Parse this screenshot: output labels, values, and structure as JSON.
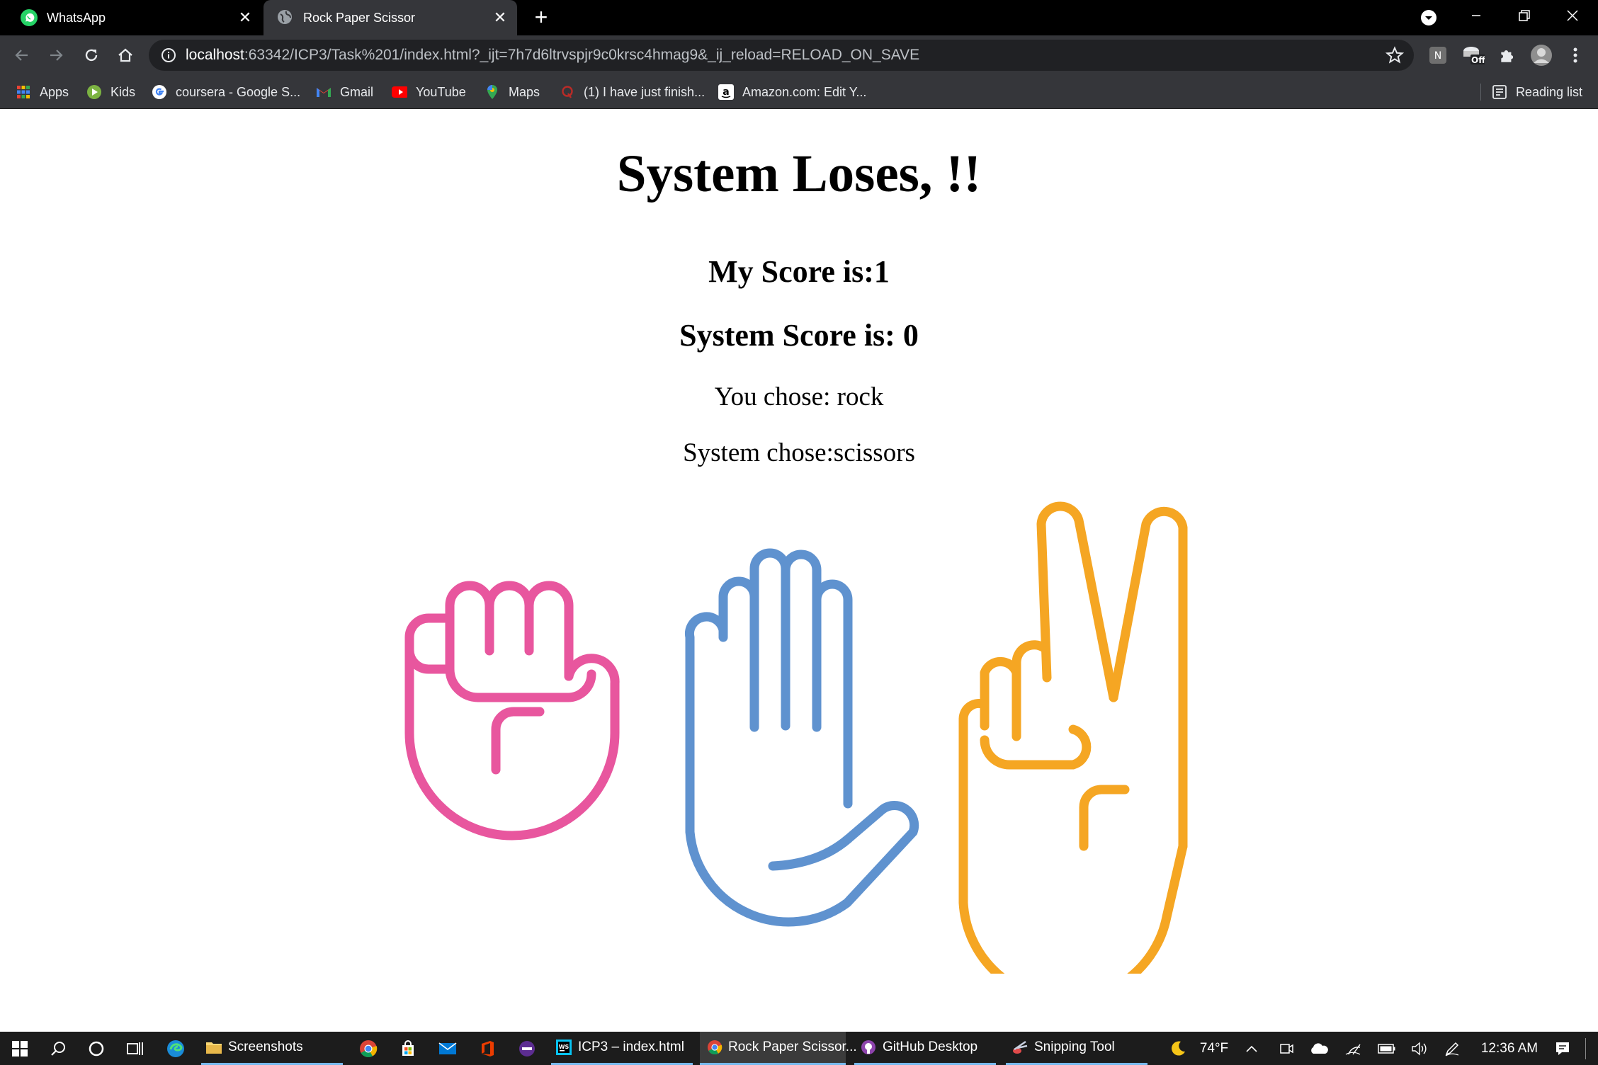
{
  "browser": {
    "tabs": [
      {
        "title": "WhatsApp",
        "icon": "whatsapp-icon",
        "active": false
      },
      {
        "title": "Rock Paper Scissor",
        "icon": "globe-icon",
        "active": true
      }
    ],
    "new_tab_label": "+",
    "address_bar": {
      "host": "localhost",
      "rest": ":63342/ICP3/Task%201/index.html?_ijt=7h7d6ltrvspjr9c0krsc4hmag9&_ij_reload=RELOAD_ON_SAVE"
    },
    "extension_badge": "Off",
    "bookmarks": [
      {
        "label": "Apps",
        "icon": "apps-grid-icon"
      },
      {
        "label": "Kids",
        "icon": "kids-icon"
      },
      {
        "label": "coursera - Google S...",
        "icon": "google-icon"
      },
      {
        "label": "Gmail",
        "icon": "gmail-icon"
      },
      {
        "label": "YouTube",
        "icon": "youtube-icon"
      },
      {
        "label": "Maps",
        "icon": "maps-icon"
      },
      {
        "label": "(1) I have just finish...",
        "icon": "quora-icon"
      },
      {
        "label": "Amazon.com: Edit Y...",
        "icon": "amazon-icon"
      }
    ],
    "reading_list_label": "Reading list"
  },
  "page": {
    "result": "System Loses, !!",
    "my_score": "My Score is:1",
    "system_score": "System Score is: 0",
    "you_chose": "You chose: rock",
    "system_chose": "System chose:scissors",
    "choices": [
      {
        "name": "rock",
        "color": "#e8569e"
      },
      {
        "name": "paper",
        "color": "#5f92cf"
      },
      {
        "name": "scissors",
        "color": "#f5a623"
      }
    ]
  },
  "taskbar": {
    "apps": [
      {
        "label": "Screenshots",
        "icon": "folder-icon"
      },
      {
        "label": "ICP3 – index.html",
        "icon": "webstorm-icon"
      },
      {
        "label": "Rock Paper Scissor...",
        "icon": "chrome-icon"
      },
      {
        "label": "GitHub Desktop",
        "icon": "github-icon"
      },
      {
        "label": "Snipping Tool",
        "icon": "snipping-tool-icon"
      }
    ],
    "weather": "74°F",
    "time": "12:36 AM"
  }
}
